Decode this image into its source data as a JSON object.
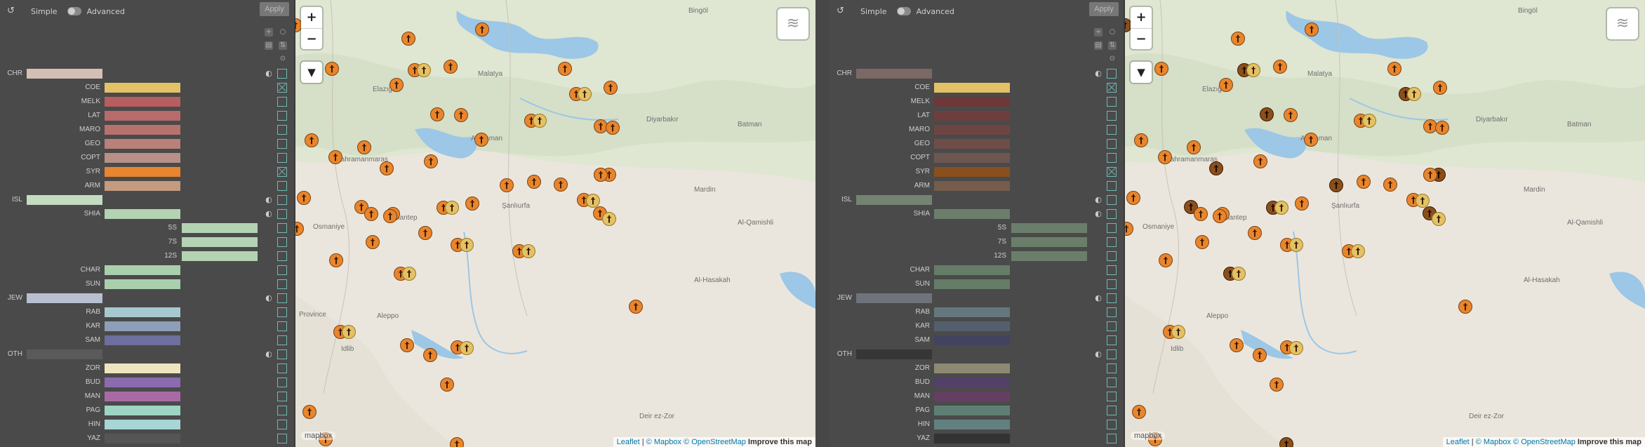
{
  "panels": [
    {
      "topbar": {
        "reset_icon": "↺",
        "simple_label": "Simple",
        "advanced_label": "Advanced",
        "apply_label": "Apply"
      },
      "rows": [
        {
          "code": "CHR",
          "level": 0,
          "color": "#d4bfb5",
          "checked": false,
          "half": true
        },
        {
          "code": "COE",
          "level": 1,
          "color": "#e3c167",
          "checked": true
        },
        {
          "code": "MELK",
          "level": 1,
          "color": "#b85e5e",
          "checked": false
        },
        {
          "code": "LAT",
          "level": 1,
          "color": "#b86b6b",
          "checked": false
        },
        {
          "code": "MARO",
          "level": 1,
          "color": "#b8726e",
          "checked": false
        },
        {
          "code": "GEO",
          "level": 1,
          "color": "#b8817a",
          "checked": false
        },
        {
          "code": "COPT",
          "level": 1,
          "color": "#b89088",
          "checked": false
        },
        {
          "code": "SYR",
          "level": 1,
          "color": "#e8852d",
          "checked": true
        },
        {
          "code": "ARM",
          "level": 1,
          "color": "#c49a80",
          "checked": false
        },
        {
          "code": "ISL",
          "level": 0,
          "color": "#c3dbc0",
          "checked": false,
          "half": true
        },
        {
          "code": "SHIA",
          "level": 1,
          "color": "#b3d3b3",
          "checked": false,
          "half": true
        },
        {
          "code": "5S",
          "level": 2,
          "color": "#b3d3b3",
          "checked": false
        },
        {
          "code": "7S",
          "level": 2,
          "color": "#b3d3b3",
          "checked": false
        },
        {
          "code": "12S",
          "level": 2,
          "color": "#b3d3b3",
          "checked": false
        },
        {
          "code": "CHAR",
          "level": 1,
          "color": "#a9cfad",
          "checked": false
        },
        {
          "code": "SUN",
          "level": 1,
          "color": "#a9cfad",
          "checked": false
        },
        {
          "code": "JEW",
          "level": 0,
          "color": "#b8c0cf",
          "checked": false,
          "half": true
        },
        {
          "code": "RAB",
          "level": 1,
          "color": "#a8c8cf",
          "checked": false
        },
        {
          "code": "KAR",
          "level": 1,
          "color": "#8d9fb8",
          "checked": false
        },
        {
          "code": "SAM",
          "level": 1,
          "color": "#6e6f9f",
          "checked": false
        },
        {
          "code": "OTH",
          "level": 0,
          "color": "#5a5a5a",
          "checked": false,
          "half": true
        },
        {
          "code": "ZOR",
          "level": 1,
          "color": "#ede5bf",
          "checked": false
        },
        {
          "code": "BUD",
          "level": 1,
          "color": "#8b6bb0",
          "checked": false
        },
        {
          "code": "MAN",
          "level": 1,
          "color": "#a86aa5",
          "checked": false
        },
        {
          "code": "PAG",
          "level": 1,
          "color": "#9fd4c4",
          "checked": false
        },
        {
          "code": "HIN",
          "level": 1,
          "color": "#a6d6d6",
          "checked": false
        },
        {
          "code": "YAZ",
          "level": 1,
          "color": "#555555",
          "checked": false
        }
      ],
      "map": {
        "zoom_in": "+",
        "zoom_out": "−",
        "filter_icon": "▼",
        "layers_icon": "≋",
        "places": [
          "Bingöl",
          "Elazığ",
          "Malatya",
          "Diyarbakır",
          "Batman",
          "Adıyaman",
          "Kahramanmaraş",
          "Şanlıurfa",
          "Gaziantep",
          "Mardin",
          "Al-Qamishli",
          "Al-Hasakah",
          "Aleppo",
          "Idlib",
          "Deir ez-Zor",
          "Osmaniye",
          "Province"
        ],
        "attribution": {
          "leaflet": "Leaflet",
          "mapbox": "© Mapbox",
          "osm": "© OpenStreetMap",
          "improve": "Improve this map",
          "logo": "mapbox"
        },
        "marker_colors": {
          "syr": "#e8852d",
          "coe": "#e3c167"
        }
      }
    },
    {
      "topbar": {
        "reset_icon": "↺",
        "simple_label": "Simple",
        "advanced_label": "Advanced",
        "apply_label": "Apply"
      },
      "rows": [
        {
          "code": "CHR",
          "level": 0,
          "color": "#7a6964",
          "checked": false,
          "half": true
        },
        {
          "code": "COE",
          "level": 1,
          "color": "#e3c167",
          "checked": true
        },
        {
          "code": "MELK",
          "level": 1,
          "color": "#6e3838",
          "checked": false
        },
        {
          "code": "LAT",
          "level": 1,
          "color": "#6e3e3e",
          "checked": false
        },
        {
          "code": "MARO",
          "level": 1,
          "color": "#6e4442",
          "checked": false
        },
        {
          "code": "GEO",
          "level": 1,
          "color": "#6e4d49",
          "checked": false
        },
        {
          "code": "COPT",
          "level": 1,
          "color": "#6e5651",
          "checked": false
        },
        {
          "code": "SYR",
          "level": 1,
          "color": "#8a4f1c",
          "checked": true
        },
        {
          "code": "ARM",
          "level": 1,
          "color": "#765c4c",
          "checked": false
        },
        {
          "code": "ISL",
          "level": 0,
          "color": "#748372",
          "checked": false,
          "half": true
        },
        {
          "code": "SHIA",
          "level": 1,
          "color": "#6b7e6b",
          "checked": false,
          "half": true
        },
        {
          "code": "5S",
          "level": 2,
          "color": "#6b7e6b",
          "checked": false
        },
        {
          "code": "7S",
          "level": 2,
          "color": "#6b7e6b",
          "checked": false
        },
        {
          "code": "12S",
          "level": 2,
          "color": "#6b7e6b",
          "checked": false
        },
        {
          "code": "CHAR",
          "level": 1,
          "color": "#657c68",
          "checked": false
        },
        {
          "code": "SUN",
          "level": 1,
          "color": "#657c68",
          "checked": false
        },
        {
          "code": "JEW",
          "level": 0,
          "color": "#6e737c",
          "checked": false,
          "half": true
        },
        {
          "code": "RAB",
          "level": 1,
          "color": "#65777c",
          "checked": false
        },
        {
          "code": "KAR",
          "level": 1,
          "color": "#545f6e",
          "checked": false
        },
        {
          "code": "SAM",
          "level": 1,
          "color": "#42435f",
          "checked": false
        },
        {
          "code": "OTH",
          "level": 0,
          "color": "#363636",
          "checked": false,
          "half": true
        },
        {
          "code": "ZOR",
          "level": 1,
          "color": "#8e8972",
          "checked": false
        },
        {
          "code": "BUD",
          "level": 1,
          "color": "#534069",
          "checked": false
        },
        {
          "code": "MAN",
          "level": 1,
          "color": "#653f63",
          "checked": false
        },
        {
          "code": "PAG",
          "level": 1,
          "color": "#5f7f75",
          "checked": false
        },
        {
          "code": "HIN",
          "level": 1,
          "color": "#638080",
          "checked": false
        },
        {
          "code": "YAZ",
          "level": 1,
          "color": "#333333",
          "checked": false
        }
      ],
      "map": {
        "zoom_in": "+",
        "zoom_out": "−",
        "filter_icon": "▼",
        "layers_icon": "≋",
        "places": [
          "Bingöl",
          "Elazığ",
          "Malatya",
          "Diyarbakır",
          "Batman",
          "Adıyaman",
          "Kahramanmaraş",
          "Şanlıurfa",
          "Gaziantep",
          "Mardin",
          "Al-Qamishli",
          "Al-Hasakah",
          "Aleppo",
          "Idlib",
          "Deir ez-Zor",
          "Osmaniye"
        ],
        "attribution": {
          "leaflet": "Leaflet",
          "mapbox": "© Mapbox",
          "osm": "© OpenStreetMap",
          "improve": "Improve this map",
          "logo": "mapbox"
        },
        "marker_colors": {
          "syr": "#e8852d",
          "syr_dark": "#8a4f1c",
          "coe": "#e3c167"
        }
      }
    }
  ]
}
